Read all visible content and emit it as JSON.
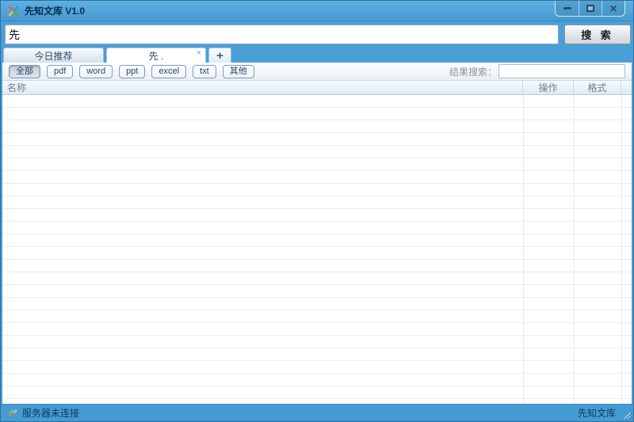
{
  "window": {
    "title": "先知文库 V1.0",
    "controls": {
      "minimize": "minimize",
      "maximize": "maximize",
      "close": "✕"
    }
  },
  "search": {
    "value": "先",
    "button_label": "搜 索"
  },
  "tabs": [
    {
      "label": "今日推荐"
    },
    {
      "label": "先 .",
      "close": "×"
    },
    {
      "label": "+"
    }
  ],
  "toolbar": {
    "filters": [
      "全部",
      "pdf",
      "word",
      "ppt",
      "excel",
      "txt",
      "其他"
    ],
    "active_filter": "全部",
    "result_search_label": "结果搜索：",
    "result_search_value": ""
  },
  "table": {
    "columns": [
      "名称",
      "操作",
      "格式"
    ],
    "rows": []
  },
  "status_bar": {
    "left": "服务器未连接",
    "right": "先知文库"
  },
  "colors": {
    "accent_blue": "#4a9fd7",
    "titlebar_gradient_top": "#5fb0e2",
    "titlebar_gradient_bottom": "#459ad2",
    "header_text": "#70808f",
    "status_text": "#0e3a5c"
  }
}
